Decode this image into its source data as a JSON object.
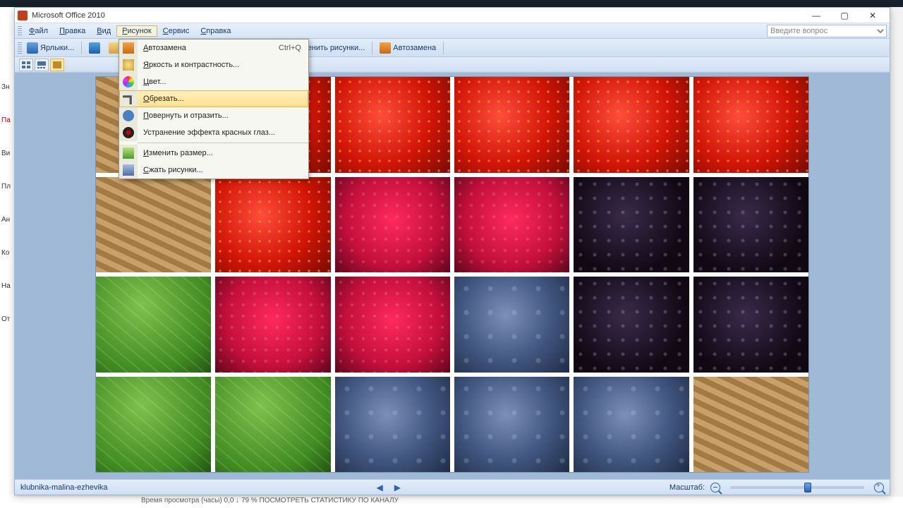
{
  "app": {
    "title": "Microsoft Office 2010"
  },
  "window_controls": {
    "min": "—",
    "max": "▢",
    "close": "✕"
  },
  "menubar": {
    "items": [
      "Файл",
      "Правка",
      "Вид",
      "Рисунок",
      "Сервис",
      "Справка"
    ],
    "open_index": 3,
    "search_placeholder": "Введите вопрос"
  },
  "toolbar": {
    "shortcuts": "Ярлыки...",
    "edit_pictures": "Изменить рисунки...",
    "autocorrect": "Автозамена"
  },
  "dropdown": {
    "items": [
      {
        "icon": "ic-auto",
        "label": "Автозамена",
        "accel": "Ctrl+Q",
        "u": 0
      },
      {
        "icon": "ic-bright",
        "label": "Яркость и контрастность...",
        "accel": "",
        "u": 0
      },
      {
        "icon": "ic-color",
        "label": "Цвет...",
        "accel": "",
        "u": 0
      },
      {
        "icon": "ic-crop",
        "label": "Обрезать...",
        "accel": "",
        "u": 0,
        "hover": true
      },
      {
        "icon": "ic-rotate",
        "label": "Повернуть и отразить...",
        "accel": "",
        "u": 0
      },
      {
        "icon": "ic-redeye",
        "label": "Устранение эффекта красных глаз...",
        "accel": "",
        "u": -1
      },
      {
        "sep": true
      },
      {
        "icon": "ic-resize",
        "label": "Изменить размер...",
        "accel": "",
        "u": 0
      },
      {
        "icon": "ic-compress",
        "label": "Сжать рисунки...",
        "accel": "",
        "u": 0
      }
    ]
  },
  "image": {
    "cells": [
      "mat",
      "strawberry",
      "strawberry",
      "strawberry",
      "strawberry",
      "strawberry",
      "mat",
      "strawberry",
      "raspberry",
      "raspberry",
      "blackberry",
      "blackberry",
      "leaf",
      "raspberry",
      "raspberry",
      "blueberry",
      "blackberry",
      "blackberry",
      "leaf",
      "leaf",
      "blueberry",
      "blueberry",
      "blueberry",
      "mat"
    ]
  },
  "status": {
    "filename": "klubnika-malina-ezhevika",
    "zoom_label": "Масштаб:",
    "zoom_percent": 58
  },
  "background": {
    "sidebar": [
      "Зн",
      "Па",
      "Ви",
      "Пл",
      "Ан",
      "Ко",
      "На",
      "От"
    ],
    "bottom": "Время просмотра (часы)    0,0  ↓ 79 %                                                   ПОСМОТРЕТЬ СТАТИСТИКУ ПО КАНАЛУ"
  }
}
